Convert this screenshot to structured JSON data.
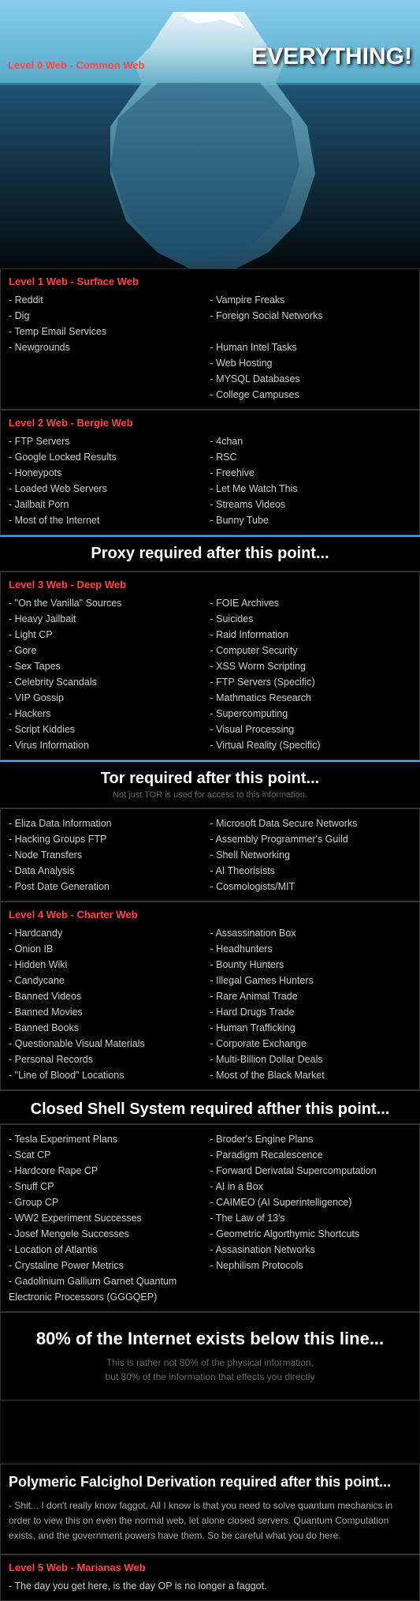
{
  "header": {
    "level0_label": "Level 0 Web - Common Web",
    "everything_text": "EVERYTHING!"
  },
  "level1": {
    "title": "Level 1 Web - Surface Web",
    "col1": [
      "- Reddit",
      "- Dig",
      "- Temp Email Services",
      "- Newgrounds"
    ],
    "col2": [
      "- Vampire Freaks",
      "- Foreign Social Networks"
    ],
    "col3": [
      "- Human Intel Tasks",
      "- Web Hosting",
      "- MYSQL Databases",
      "- College Campuses"
    ]
  },
  "level2": {
    "title": "Level 2 Web - Bergie Web",
    "col1": [
      "- FTP Servers",
      "- Google Locked Results",
      "- Honeypots",
      "- Loaded Web Servers",
      "- Jailbait Porn",
      "- Most of the Internet"
    ],
    "col2": [
      "- 4chan",
      "- RSC",
      "- Freehive",
      "- Let Me Watch This",
      "- Streams Videos",
      "- Bunny Tube"
    ]
  },
  "proxy_divider": {
    "main_text": "Proxy required after this point..."
  },
  "level3": {
    "title": "Level 3 Web - Deep Web",
    "col1": [
      "- \"On the Vanilla\" Sources",
      "- Heavy Jailbait",
      "- Light CP",
      "- Gore",
      "- Sex Tapes",
      "- Celebrity Scandals",
      "- VIP Gossip",
      "- Hackers",
      "- Script Kiddies",
      "- Virus Information"
    ],
    "col2": [
      "- FOIE Archives",
      "- Suicides",
      "- Raid Information",
      "- Computer Security",
      "- XSS Worm Scripting",
      "- FTP Servers (Specific)",
      "- Mathmatics Research",
      "- Supercomputing",
      "- Visual Processing",
      "- Virtual Reality (Specific)"
    ]
  },
  "tor_divider": {
    "main_text": "Tor required after this point...",
    "sub_text": "Not just TOR is used for access to this information."
  },
  "tor_section": {
    "col1": [
      "- Eliza Data Information",
      "- Hacking Groups FTP",
      "- Node Transfers",
      "- Data Analysis",
      "- Post Date Generation"
    ],
    "col2": [
      "- Microsoft Data Secure Networks",
      "- Assembly Programmer's Guild",
      "- Shell Networking",
      "- AI Theorisists",
      "- Cosmologists/MIT"
    ]
  },
  "level4": {
    "title": "Level 4 Web - Charter Web",
    "col1": [
      "- Hardcandy",
      "- Onion IB",
      "- Hidden Wiki",
      "- Candycane",
      "- Banned Videos",
      "- Banned Movies",
      "- Banned Books",
      "- Questionable Visual Materials",
      "- Personal Records",
      "- \"Line of Blood\" Locations"
    ],
    "col2": [
      "- Assassination Box",
      "- Headhunters",
      "- Bounty Hunters",
      "- Illegal Games Hunters",
      "- Rare Animal Trade",
      "- Hard Drugs Trade",
      "- Human Trafficking",
      "- Corporate Exchange",
      "- Multi-Billion Dollar Deals",
      "- Most of the Black Market"
    ]
  },
  "closed_shell_divider": {
    "main_text": "Closed Shell System required afther this point..."
  },
  "closed_shell_section": {
    "col1": [
      "- Tesla Experiment Plans",
      "- Scat CP",
      "- Hardcore Rape CP",
      "- Snuff CP",
      "- Group CP",
      "- WW2 Experiment Successes",
      "- Josef Mengele Successes",
      "- Location of Atlantis",
      "- Crystaline Power Metrics",
      "- Gadolinium Gallium Garnet Quantum Electronic Processors (GGGQEP)"
    ],
    "col2": [
      "- Broder's Engine Plans",
      "- Paradigm Recalescence",
      "- Forward Derivatal Supercomputation",
      "- AI in a Box",
      "- CAIMEO (AI Superintelligence)",
      "- The Law of 13's",
      "- Geometric Algorthymic Shortcuts",
      "- Assasination Networks",
      "- Nephilism Protocols"
    ]
  },
  "eighty_percent": {
    "big_text": "80% of the Internet exists below this line...",
    "small_text": "This is rather not 80% of the physical information,\nbut 80% of the information that effects you directly"
  },
  "polymeric": {
    "title": "Polymeric Falcighol Derivation required after this point...",
    "body": "- Shit... I don't really know faggot. All I know is that you need to solve quantum mechanics in order to view this on even the normal web, let alone closed servers. Quantum Computation exists, and the government powers have them. So be careful what you do here."
  },
  "level5": {
    "title": "Level 5 Web - Marianas Web",
    "item": "- The day you get here, is the day OP is no longer a faggot."
  }
}
